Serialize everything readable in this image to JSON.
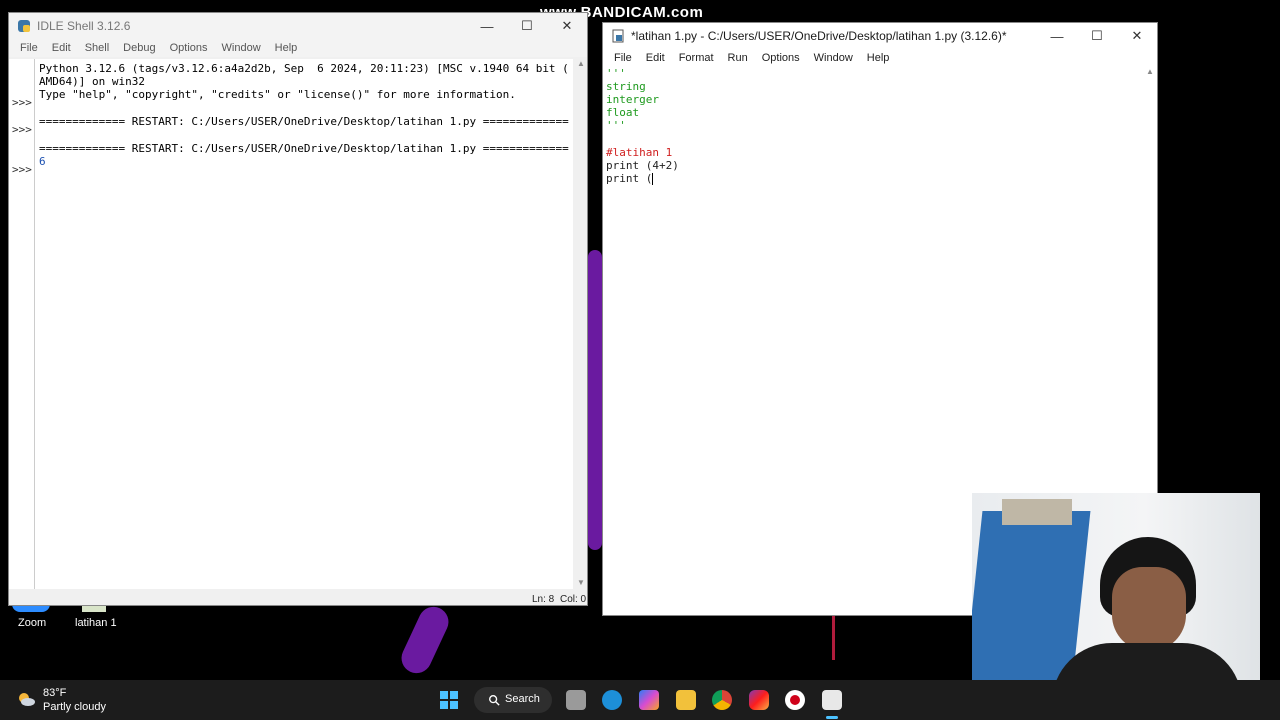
{
  "watermark": "www.BANDICAM.com",
  "shell": {
    "title": "IDLE Shell 3.12.6",
    "menu": [
      "File",
      "Edit",
      "Shell",
      "Debug",
      "Options",
      "Window",
      "Help"
    ],
    "lines": [
      "Python 3.12.6 (tags/v3.12.6:a4a2d2b, Sep  6 2024, 20:11:23) [MSC v.1940 64 bit (",
      "AMD64)] on win32",
      "Type \"help\", \"copyright\", \"credits\" or \"license()\" for more information.",
      "",
      "============= RESTART: C:/Users/USER/OneDrive/Desktop/latihan 1.py =============",
      "",
      "============= RESTART: C:/Users/USER/OneDrive/Desktop/latihan 1.py =============",
      "6"
    ],
    "prompts": [
      ">>>",
      ">>>",
      ">>>"
    ],
    "status": {
      "ln": "Ln: 8",
      "col": "Col: 0"
    }
  },
  "editor": {
    "title": "*latihan 1.py - C:/Users/USER/OneDrive/Desktop/latihan 1.py (3.12.6)*",
    "menu": [
      "File",
      "Edit",
      "Format",
      "Run",
      "Options",
      "Window",
      "Help"
    ],
    "code": {
      "l1": "'''",
      "l2": "string",
      "l3": "interger",
      "l4": "float",
      "l5": "'''",
      "l6": "",
      "l7": "#latihan 1",
      "l8": "print (4+2)",
      "l9": "print ("
    }
  },
  "desktop_icons": [
    "Zoom",
    "latihan 1"
  ],
  "weather": {
    "temp": "83°F",
    "desc": "Partly cloudy"
  },
  "taskbar": {
    "search_label": "Search"
  },
  "colors": {
    "string": "#1e9a1e",
    "comment": "#d02020",
    "taskbar": "#1c1c1c"
  }
}
